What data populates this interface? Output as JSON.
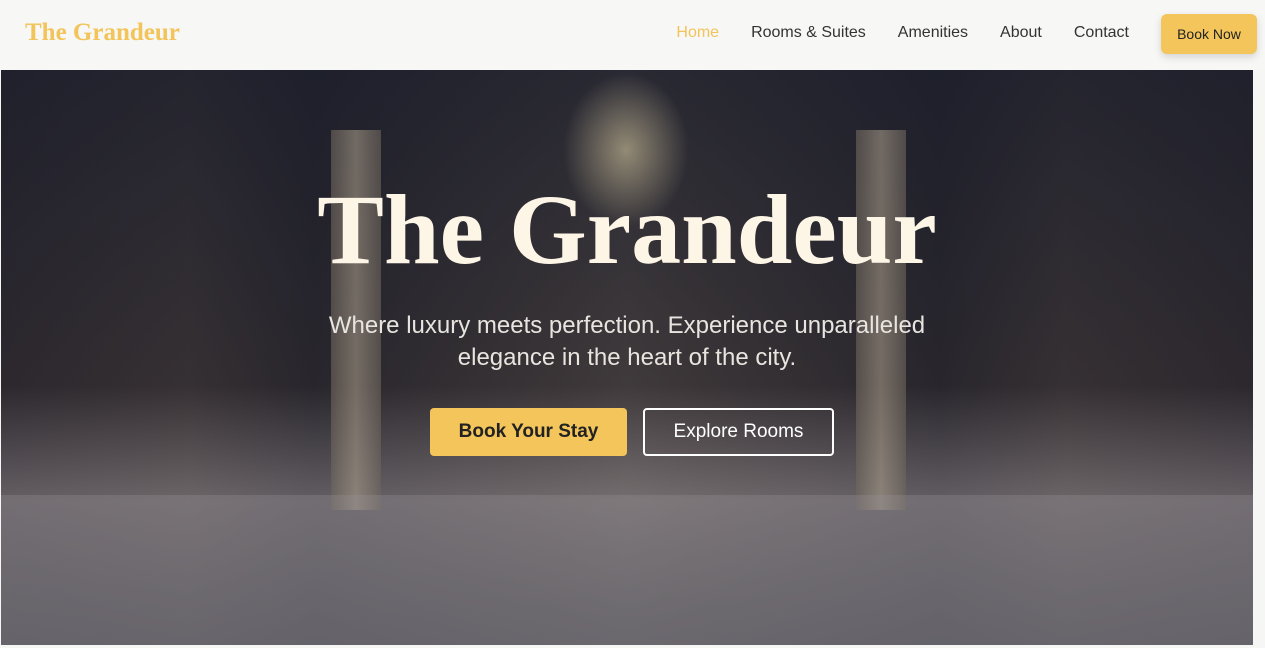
{
  "nav": {
    "logo": "The Grandeur",
    "links": [
      "Home",
      "Rooms & Suites",
      "Amenities",
      "About",
      "Contact"
    ],
    "cta": "Book Now"
  },
  "hero": {
    "title": "The Grandeur",
    "subtitle": "Where luxury meets perfection. Experience unparalleled elegance in the heart of the city.",
    "primary": "Book Your Stay",
    "secondary": "Explore Rooms"
  },
  "colors": {
    "accent": "#f3c55b"
  }
}
